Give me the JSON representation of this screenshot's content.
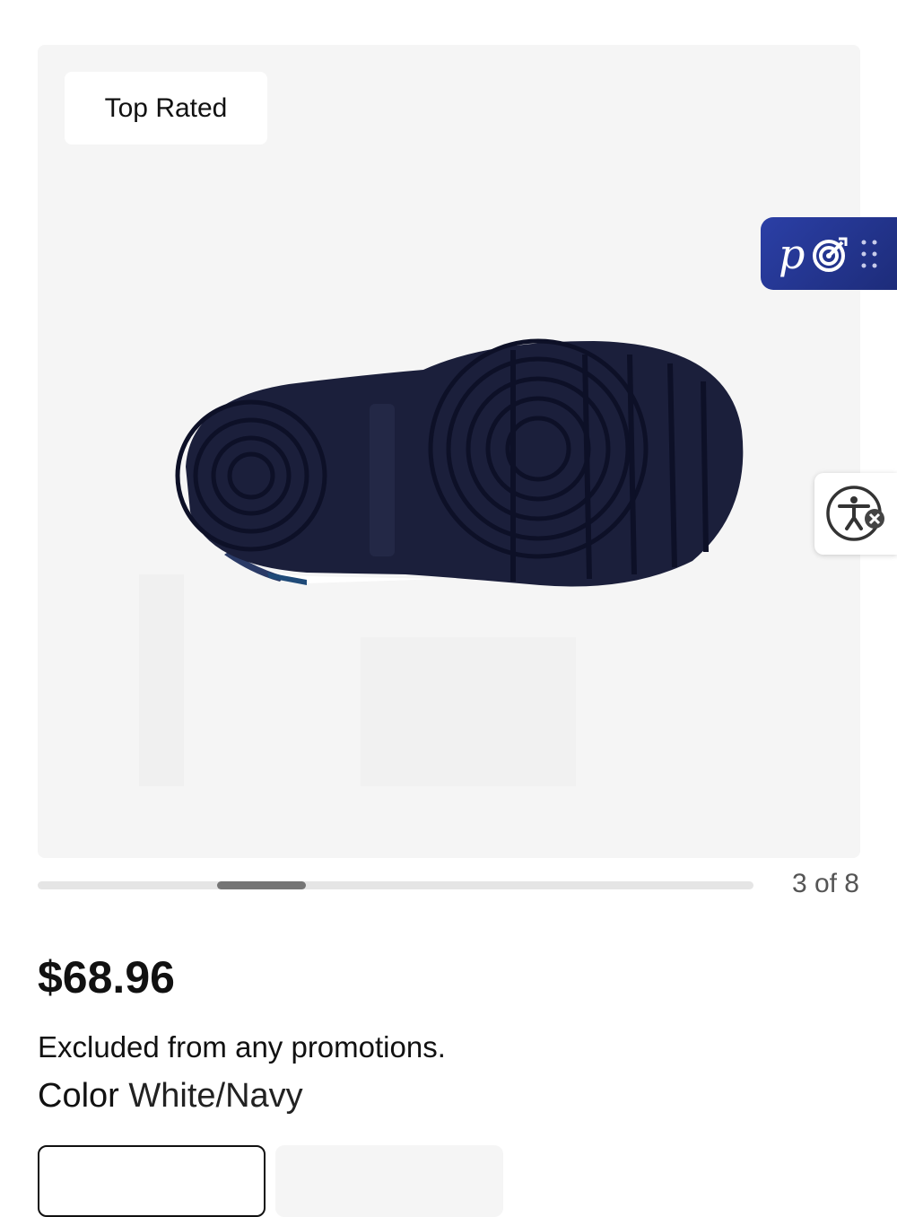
{
  "gallery": {
    "badge": "Top Rated",
    "image_alt": "sneaker-outsole",
    "counter": "3 of 8",
    "progress": {
      "index": 3,
      "total": 8
    }
  },
  "product": {
    "price": "$68.96",
    "promotion_note": "Excluded from any promotions.",
    "color_label": "Color",
    "color_value": "White/Navy"
  },
  "widgets": {
    "promo_letter": "p",
    "icons": [
      "target-icon",
      "drag-handle-icon",
      "accessibility-icon",
      "close-icon"
    ]
  },
  "colors": {
    "sole": "#1b1f3b",
    "widget": "#24358f",
    "track": "#e5e5e5",
    "thumb": "#757575"
  }
}
